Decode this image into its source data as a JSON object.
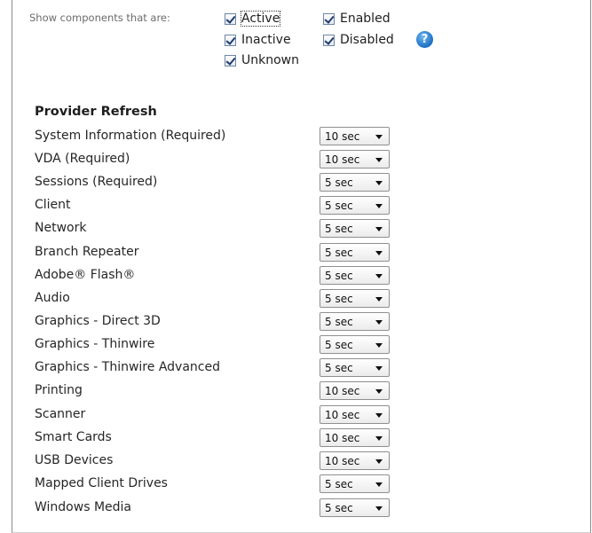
{
  "filter": {
    "label": "Show components that are:",
    "options": [
      {
        "label": "Active",
        "checked": true,
        "focused": true
      },
      {
        "label": "Inactive",
        "checked": true
      },
      {
        "label": "Unknown",
        "checked": true
      },
      {
        "label": "Enabled",
        "checked": true
      },
      {
        "label": "Disabled",
        "checked": true
      }
    ],
    "help_icon": "question-circle-icon",
    "help_glyph": "?"
  },
  "provider_refresh": {
    "title": "Provider Refresh",
    "rows": [
      {
        "label": "System Information (Required)",
        "value": "10 sec"
      },
      {
        "label": "VDA (Required)",
        "value": "10 sec"
      },
      {
        "label": "Sessions (Required)",
        "value": "5 sec"
      },
      {
        "label": "Client",
        "value": "5 sec"
      },
      {
        "label": "Network",
        "value": "5 sec"
      },
      {
        "label": "Branch Repeater",
        "value": "5 sec"
      },
      {
        "label": "Adobe® Flash®",
        "value": "5 sec"
      },
      {
        "label": "Audio",
        "value": "5 sec"
      },
      {
        "label": "Graphics - Direct 3D",
        "value": "5 sec"
      },
      {
        "label": "Graphics - Thinwire",
        "value": "5 sec"
      },
      {
        "label": "Graphics - Thinwire Advanced",
        "value": "5 sec"
      },
      {
        "label": "Printing",
        "value": "10 sec"
      },
      {
        "label": "Scanner",
        "value": "10 sec"
      },
      {
        "label": "Smart Cards",
        "value": "10 sec"
      },
      {
        "label": "USB Devices",
        "value": "10 sec"
      },
      {
        "label": "Mapped Client Drives",
        "value": "5 sec"
      },
      {
        "label": "Windows Media",
        "value": "5 sec"
      }
    ]
  }
}
